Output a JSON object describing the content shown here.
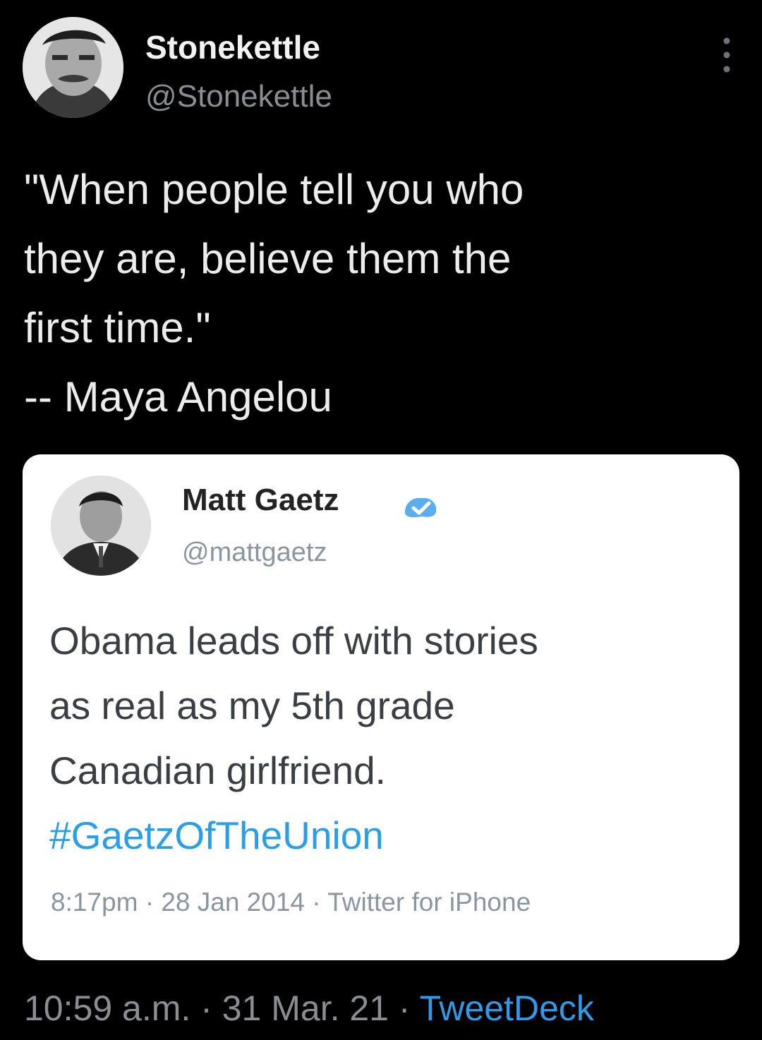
{
  "tweet": {
    "author": {
      "display_name": "Stonekettle",
      "handle": "@Stonekettle"
    },
    "more_icon": "more-vertical-icon",
    "text": "\"When people tell you who\nthey are, believe them the\nfirst time.\"\n-- Maya Angelou",
    "timestamp": "10:59 a.m.",
    "date": "31 Mar. 21",
    "separator": "·",
    "source": "TweetDeck",
    "source_color": "#2f9be8"
  },
  "quoted_tweet": {
    "author": {
      "display_name": "Matt Gaetz",
      "handle": "@mattgaetz",
      "verified_icon": "verified-badge-icon"
    },
    "text_lines": [
      "Obama leads off with stories",
      "as real as my 5th grade",
      "Canadian girlfriend."
    ],
    "hashtag": "#GaetzOfTheUnion",
    "hashtag_color": "#2b9ee8",
    "time": "8:17pm",
    "date": "28 Jan 2014",
    "separator": "·",
    "client": "Twitter for iPhone"
  }
}
